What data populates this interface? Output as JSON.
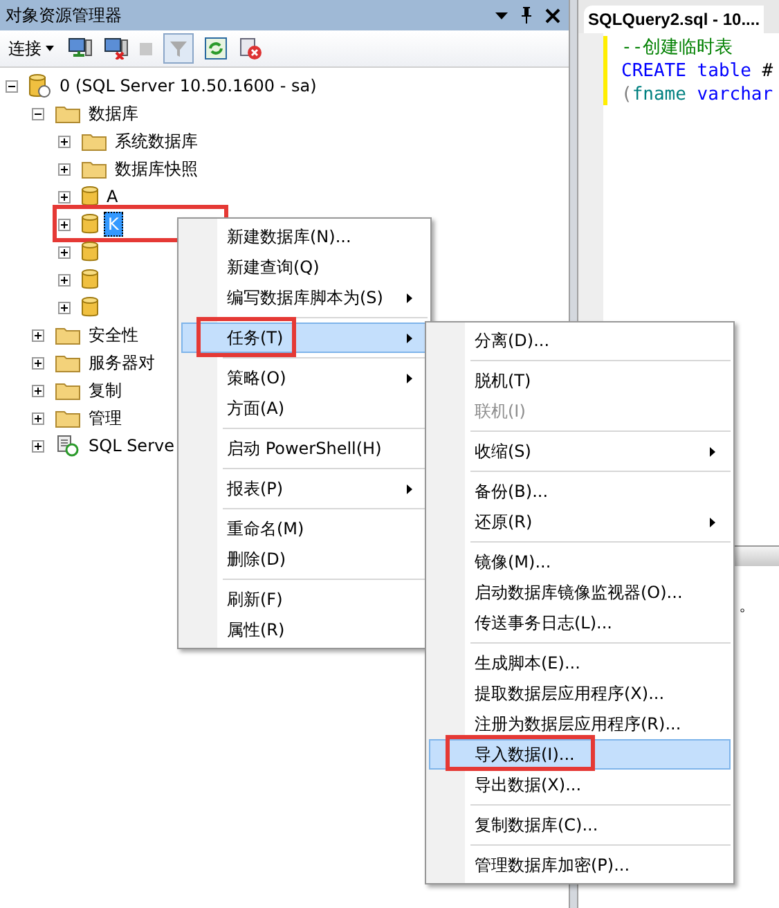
{
  "explorer": {
    "title": "对象资源管理器",
    "connect_label": "连接"
  },
  "tree": [
    {
      "label": "0 (SQL Server 10.50.1600 - sa)",
      "kind": "server",
      "expanded": true,
      "selected": false,
      "children": [
        {
          "label": "数据库",
          "kind": "folder",
          "expanded": true,
          "selected": false,
          "children": [
            {
              "label": "系统数据库",
              "kind": "folder",
              "expanded": false,
              "selected": false
            },
            {
              "label": "数据库快照",
              "kind": "folder",
              "expanded": false,
              "selected": false
            },
            {
              "label": "A",
              "kind": "database",
              "expanded": false,
              "selected": false
            },
            {
              "label": "K",
              "kind": "database",
              "expanded": false,
              "selected": true,
              "annotated": true
            },
            {
              "kind": "database",
              "expanded": false
            },
            {
              "kind": "database",
              "expanded": false
            },
            {
              "kind": "database",
              "expanded": false
            }
          ]
        },
        {
          "label": "安全性",
          "kind": "folder",
          "expanded": false,
          "selected": false
        },
        {
          "label": "服务器对",
          "kind": "folder",
          "expanded": false,
          "selected": false
        },
        {
          "label": "复制",
          "kind": "folder",
          "expanded": false,
          "selected": false
        },
        {
          "label": "管理",
          "kind": "folder",
          "expanded": false,
          "selected": false
        },
        {
          "label": "SQL Serve",
          "kind": "agent",
          "expanded": false,
          "selected": false
        }
      ]
    }
  ],
  "editor": {
    "tab": "SQLQuery2.sql - 10....",
    "lines": [
      [
        {
          "kind": "comment",
          "text": "--创建临时表"
        }
      ],
      [
        {
          "kind": "keyword",
          "text": "CREATE"
        },
        {
          "kind": "keyword",
          "text": " table"
        },
        {
          "kind": "plain",
          "text": " #"
        }
      ],
      [
        {
          "kind": "punct",
          "text": "("
        },
        {
          "kind": "name",
          "text": "fname"
        },
        {
          "kind": "keyword",
          "text": " varchar"
        }
      ]
    ]
  },
  "results_fragment": "。",
  "context_menu": [
    {
      "kind": "item",
      "label": "新建数据库(N)...",
      "submenu": false,
      "selected": false
    },
    {
      "kind": "item",
      "label": "新建查询(Q)",
      "submenu": false,
      "selected": false
    },
    {
      "kind": "item",
      "label": "编写数据库脚本为(S)",
      "submenu": true,
      "selected": false
    },
    {
      "kind": "separator"
    },
    {
      "kind": "item",
      "label": "任务(T)",
      "submenu": true,
      "selected": true,
      "annotated": true
    },
    {
      "kind": "separator"
    },
    {
      "kind": "item",
      "label": "策略(O)",
      "submenu": true,
      "selected": false
    },
    {
      "kind": "item",
      "label": "方面(A)",
      "submenu": false,
      "selected": false
    },
    {
      "kind": "separator"
    },
    {
      "kind": "item",
      "label": "启动 PowerShell(H)",
      "submenu": false,
      "selected": false
    },
    {
      "kind": "separator"
    },
    {
      "kind": "item",
      "label": "报表(P)",
      "submenu": true,
      "selected": false
    },
    {
      "kind": "separator"
    },
    {
      "kind": "item",
      "label": "重命名(M)",
      "submenu": false,
      "selected": false
    },
    {
      "kind": "item",
      "label": "删除(D)",
      "submenu": false,
      "selected": false
    },
    {
      "kind": "separator"
    },
    {
      "kind": "item",
      "label": "刷新(F)",
      "submenu": false,
      "selected": false
    },
    {
      "kind": "item",
      "label": "属性(R)",
      "submenu": false,
      "selected": false
    }
  ],
  "tasks_submenu": [
    {
      "kind": "item",
      "label": "分离(D)...",
      "submenu": false,
      "selected": false,
      "disabled": false
    },
    {
      "kind": "separator"
    },
    {
      "kind": "item",
      "label": "脱机(T)",
      "submenu": false,
      "selected": false,
      "disabled": false
    },
    {
      "kind": "item",
      "label": "联机(I)",
      "submenu": false,
      "selected": false,
      "disabled": true
    },
    {
      "kind": "separator"
    },
    {
      "kind": "item",
      "label": "收缩(S)",
      "submenu": true,
      "selected": false,
      "disabled": false
    },
    {
      "kind": "separator"
    },
    {
      "kind": "item",
      "label": "备份(B)...",
      "submenu": false,
      "selected": false,
      "disabled": false
    },
    {
      "kind": "item",
      "label": "还原(R)",
      "submenu": true,
      "selected": false,
      "disabled": false
    },
    {
      "kind": "separator"
    },
    {
      "kind": "item",
      "label": "镜像(M)...",
      "submenu": false,
      "selected": false,
      "disabled": false
    },
    {
      "kind": "item",
      "label": "启动数据库镜像监视器(O)...",
      "submenu": false,
      "selected": false,
      "disabled": false
    },
    {
      "kind": "item",
      "label": "传送事务日志(L)...",
      "submenu": false,
      "selected": false,
      "disabled": false
    },
    {
      "kind": "separator"
    },
    {
      "kind": "item",
      "label": "生成脚本(E)...",
      "submenu": false,
      "selected": false,
      "disabled": false
    },
    {
      "kind": "item",
      "label": "提取数据层应用程序(X)...",
      "submenu": false,
      "selected": false,
      "disabled": false
    },
    {
      "kind": "item",
      "label": "注册为数据层应用程序(R)...",
      "submenu": false,
      "selected": false,
      "disabled": false
    },
    {
      "kind": "item",
      "label": "导入数据(I)...",
      "submenu": false,
      "selected": true,
      "disabled": false,
      "annotated": true
    },
    {
      "kind": "item",
      "label": "导出数据(X)...",
      "submenu": false,
      "selected": false,
      "disabled": false
    },
    {
      "kind": "separator"
    },
    {
      "kind": "item",
      "label": "复制数据库(C)...",
      "submenu": false,
      "selected": false,
      "disabled": false
    },
    {
      "kind": "separator"
    },
    {
      "kind": "item",
      "label": "管理数据库加密(P)...",
      "submenu": false,
      "selected": false,
      "disabled": false
    }
  ]
}
